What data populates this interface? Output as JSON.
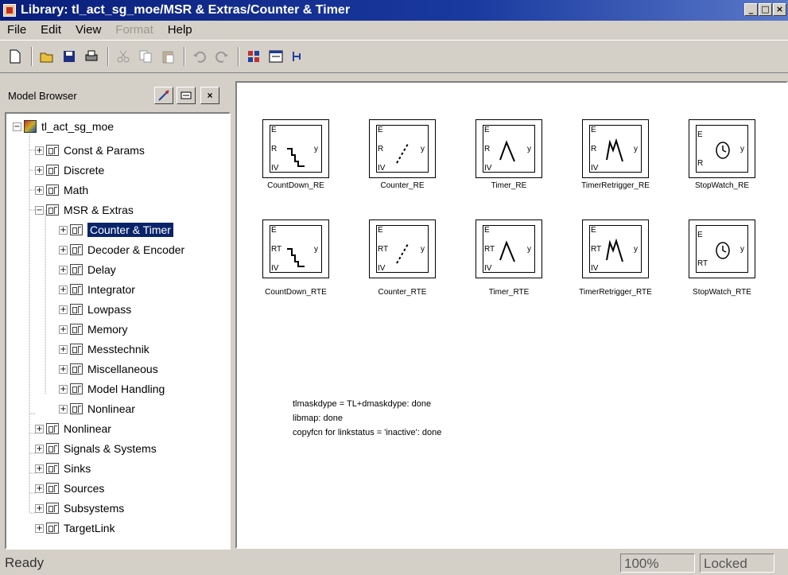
{
  "window": {
    "title": "Library: tl_act_sg_moe/MSR & Extras/Counter & Timer"
  },
  "menu": [
    "File",
    "Edit",
    "View",
    "Format",
    "Help"
  ],
  "browser": {
    "title": "Model Browser",
    "tree": [
      {
        "label": "tl_act_sg_moe",
        "expander": "−"
      },
      {
        "label": "Const & Params",
        "expander": "+"
      },
      {
        "label": "Discrete",
        "expander": "+"
      },
      {
        "label": "Math",
        "expander": "+"
      },
      {
        "label": "MSR & Extras",
        "expander": "−"
      },
      {
        "label": "Counter & Timer",
        "expander": "+"
      },
      {
        "label": "Decoder & Encoder",
        "expander": "+"
      },
      {
        "label": "Delay",
        "expander": "+"
      },
      {
        "label": "Integrator",
        "expander": "+"
      },
      {
        "label": "Lowpass",
        "expander": "+"
      },
      {
        "label": "Memory",
        "expander": "+"
      },
      {
        "label": "Messtechnik",
        "expander": "+"
      },
      {
        "label": "Miscellaneous",
        "expander": "+"
      },
      {
        "label": "Model Handling",
        "expander": "+"
      },
      {
        "label": "Nonlinear",
        "expander": "+"
      },
      {
        "label": "Nonlinear",
        "expander": "+"
      },
      {
        "label": "Signals & Systems",
        "expander": "+"
      },
      {
        "label": "Sinks",
        "expander": "+"
      },
      {
        "label": "Sources",
        "expander": "+"
      },
      {
        "label": "Subsystems",
        "expander": "+"
      },
      {
        "label": "TargetLink",
        "expander": "+"
      }
    ]
  },
  "blocks": [
    {
      "name": "CountDown_RE",
      "ports": [
        "E",
        "R",
        "IV"
      ],
      "output": "y"
    },
    {
      "name": "Counter_RE",
      "ports": [
        "E",
        "R",
        "IV"
      ],
      "output": "y"
    },
    {
      "name": "Timer_RE",
      "ports": [
        "E",
        "R",
        "IV"
      ],
      "output": "y"
    },
    {
      "name": "TimerRetrigger_RE",
      "ports": [
        "E",
        "R",
        "IV"
      ],
      "output": "y"
    },
    {
      "name": "StopWatch_RE",
      "ports": [
        "E",
        "R"
      ],
      "output": "y"
    },
    {
      "name": "CountDown_RTE",
      "ports": [
        "E",
        "RT",
        "IV"
      ],
      "output": "y"
    },
    {
      "name": "Counter_RTE",
      "ports": [
        "E",
        "RT",
        "IV"
      ],
      "output": "y"
    },
    {
      "name": "Timer_RTE",
      "ports": [
        "E",
        "RT",
        "IV"
      ],
      "output": "y"
    },
    {
      "name": "TimerRetrigger_RTE",
      "ports": [
        "E",
        "RT",
        "IV"
      ],
      "output": "y"
    },
    {
      "name": "StopWatch_RTE",
      "ports": [
        "E",
        "RT"
      ],
      "output": "y"
    }
  ],
  "notes": [
    "tlmaskdype = TL+dmaskdype: done",
    "libmap: done",
    "copyfcn for linkstatus = 'inactive': done"
  ],
  "status": {
    "ready": "Ready",
    "zoom": "100%",
    "lock": "Locked"
  }
}
